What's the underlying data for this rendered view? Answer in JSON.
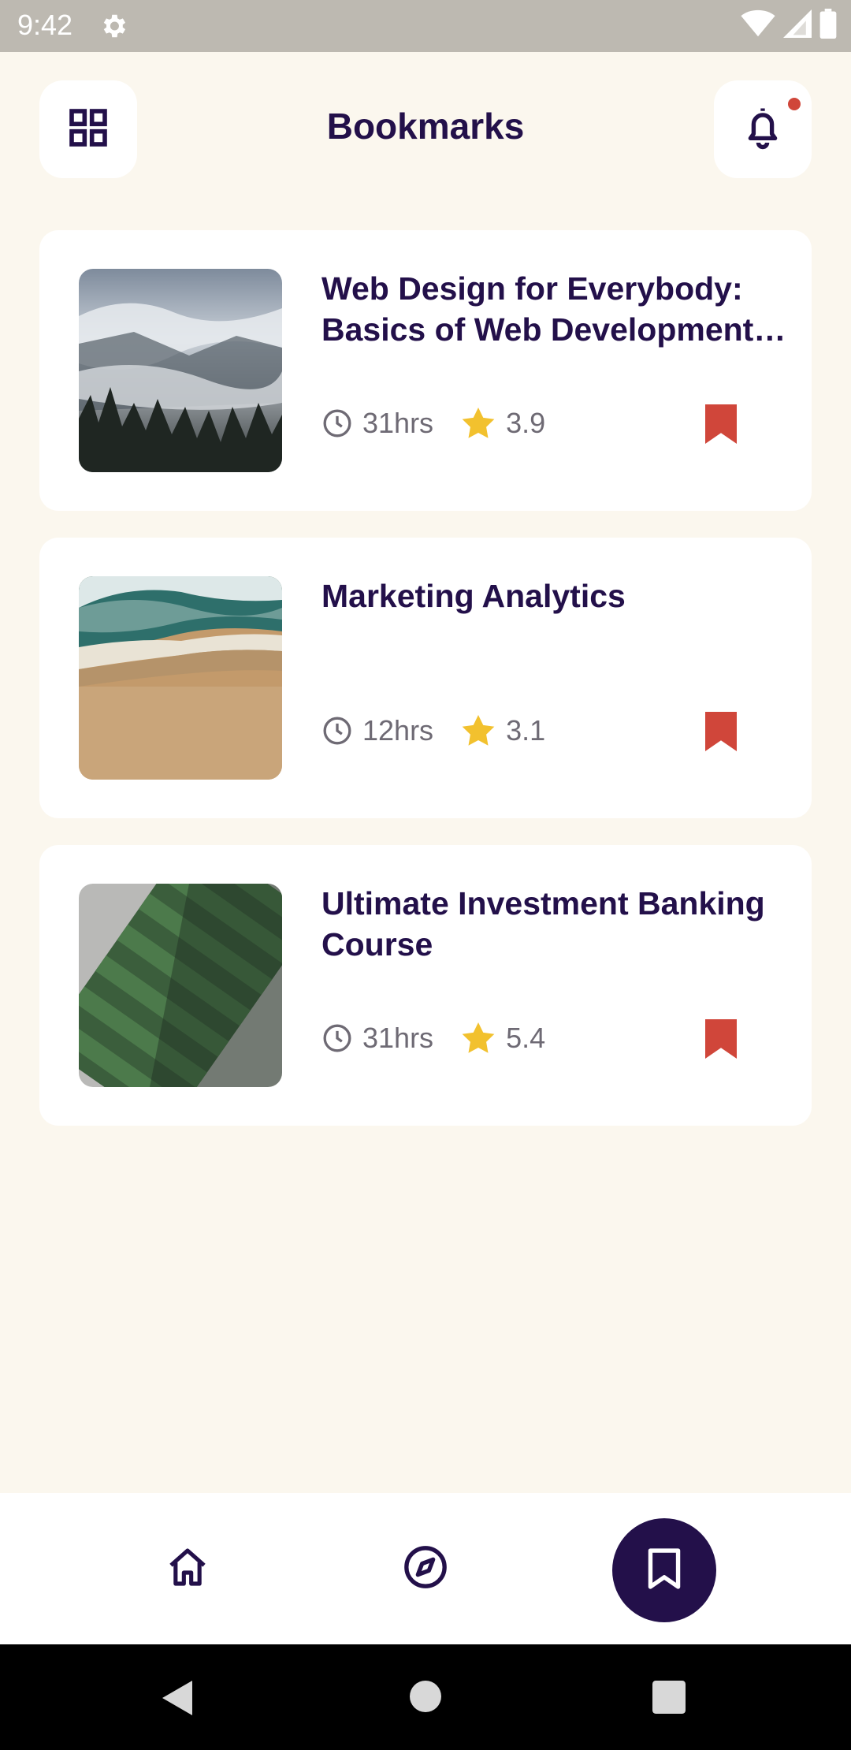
{
  "status_bar": {
    "time": "9:42",
    "icons": [
      "settings-gear-icon",
      "wifi-icon",
      "cellular-signal-icon",
      "battery-icon"
    ]
  },
  "header": {
    "title": "Bookmarks",
    "menu_icon": "grid-icon",
    "notification_icon": "bell-icon",
    "notification_badge_color": "#D0463A"
  },
  "bookmarks": [
    {
      "title": "Web Design for Everybody: Basics of Web Development & Coding",
      "duration": "31hrs",
      "rating": "3.9",
      "image": "foggy-mountain-forest"
    },
    {
      "title": "Marketing Analytics",
      "duration": "12hrs",
      "rating": "3.1",
      "image": "aerial-beach-waves"
    },
    {
      "title": "Ultimate Investment Banking Course",
      "duration": "31hrs",
      "rating": "5.4",
      "image": "aerial-soccer-field"
    }
  ],
  "bottom_nav": {
    "items": [
      "home-icon",
      "compass-icon",
      "bookmark-icon"
    ],
    "active": "bookmark-icon"
  },
  "colors": {
    "primary": "#23104A",
    "background": "#FBF7EE",
    "bookmark": "#D0463A",
    "star": "#F2C12E",
    "meta_text": "#6E6A74"
  }
}
